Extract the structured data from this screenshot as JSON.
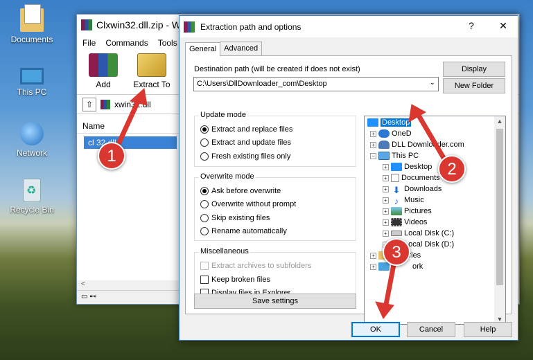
{
  "desktop": {
    "icons": [
      {
        "label": "Documents",
        "icon": "documents-folder-icon"
      },
      {
        "label": "This PC",
        "icon": "computer-icon"
      },
      {
        "label": "Network",
        "icon": "network-globe-icon"
      },
      {
        "label": "Recycle Bin",
        "icon": "recycle-bin-icon"
      }
    ]
  },
  "winrar": {
    "title": "Clxwin32.dll.zip - Wi",
    "menu": [
      "File",
      "Commands",
      "Tools"
    ],
    "toolbar": {
      "add": "Add",
      "extract": "Extract To"
    },
    "path": "Clxwin32.dll",
    "path_shown": "xwin32.dll",
    "column_name": "Name",
    "file_visible": "cl      32.dll",
    "scroll_left": "<"
  },
  "dialog": {
    "title": "Extraction path and options",
    "help": "?",
    "close": "✕",
    "tabs": [
      "General",
      "Advanced"
    ],
    "dest_label": "Destination path (will be created if does not exist)",
    "dest_value": "C:\\Users\\DllDownloader_com\\Desktop",
    "btn_display": "Display",
    "btn_new_folder": "New Folder",
    "update_mode": {
      "title": "Update mode",
      "options": [
        "Extract and replace files",
        "Extract and update files",
        "Fresh existing files only"
      ],
      "selected": 0
    },
    "overwrite_mode": {
      "title": "Overwrite mode",
      "options": [
        "Ask before overwrite",
        "Overwrite without prompt",
        "Skip existing files",
        "Rename automatically"
      ],
      "selected": 0
    },
    "misc": {
      "title": "Miscellaneous",
      "options": [
        "Extract archives to subfolders",
        "Keep broken files",
        "Display files in Explorer"
      ]
    },
    "btn_save": "Save settings",
    "tree": [
      {
        "label": "Desktop",
        "level": 0,
        "selected": true
      },
      {
        "label": "OneD",
        "level": 1
      },
      {
        "label": "DLL Downloader.com",
        "level": 1
      },
      {
        "label": "This PC",
        "level": 1
      },
      {
        "label": "Desktop",
        "level": 2
      },
      {
        "label": "Documents",
        "level": 2
      },
      {
        "label": "Downloads",
        "level": 2
      },
      {
        "label": "Music",
        "level": 2
      },
      {
        "label": "Pictures",
        "level": 2
      },
      {
        "label": "Videos",
        "level": 2
      },
      {
        "label": "Local Disk (C:)",
        "level": 2
      },
      {
        "label": "Local Disk (D:)",
        "level": 2
      },
      {
        "label": "Libraries",
        "level": 1
      },
      {
        "label": "ork",
        "level": 1
      }
    ],
    "btn_ok": "OK",
    "btn_cancel": "Cancel",
    "btn_help": "Help"
  },
  "annotations": {
    "step1": "1",
    "step2": "2",
    "step3": "3",
    "color": "#d9372f"
  }
}
